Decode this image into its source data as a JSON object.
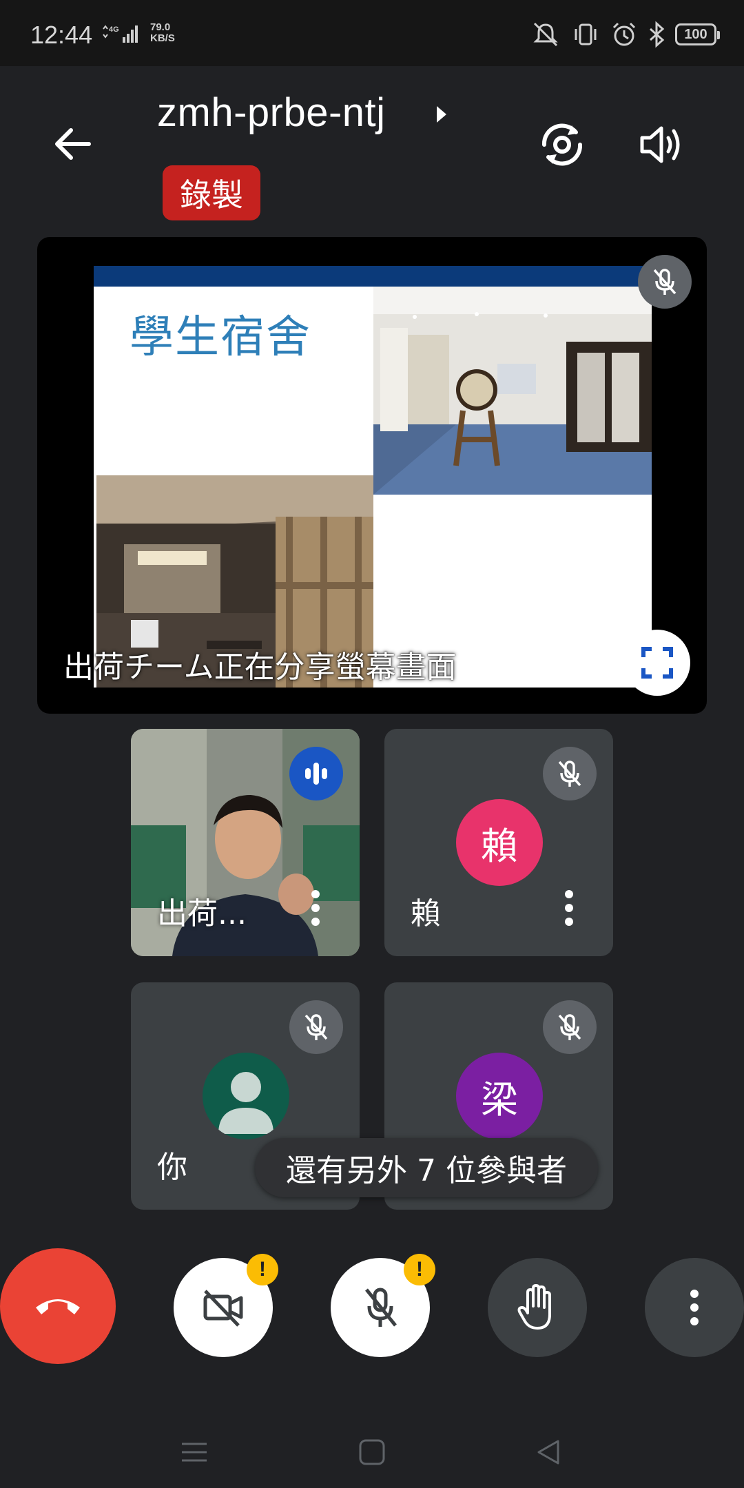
{
  "status_bar": {
    "time": "12:44",
    "network": "4G",
    "speed_value": "79.0",
    "speed_unit": "KB/S",
    "battery": "100"
  },
  "header": {
    "meeting_code": "zmh-prbe-ntj",
    "recording_label": "錄製"
  },
  "presentation": {
    "slide_title": "學生宿舍",
    "share_caption": "出荷チーム正在分享螢幕畫面"
  },
  "participants": [
    {
      "name": "出荷...",
      "initial": "",
      "video": true,
      "speaking": true
    },
    {
      "name": "賴",
      "initial": "賴",
      "color": "#e8336b",
      "muted": true
    },
    {
      "name": "你",
      "initial": "",
      "color": "#0f5c4a",
      "muted": true
    },
    {
      "name": "梁",
      "initial": "梁",
      "color": "#7b1fa2",
      "muted": true
    }
  ],
  "others_label": "還有另外 7 位參與者",
  "controls": {
    "warning_glyph": "!"
  },
  "colors": {
    "background": "#202124",
    "end_call": "#ea4335",
    "recording": "#c5221f",
    "warning": "#fbbc04",
    "speaking": "#1a56c4"
  }
}
